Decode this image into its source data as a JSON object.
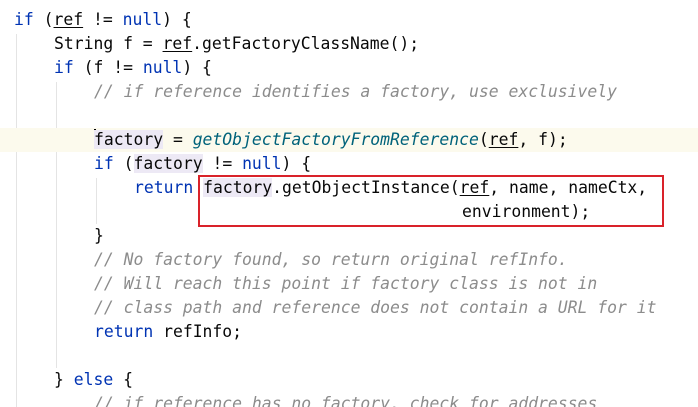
{
  "colors": {
    "keyword": "#0033b3",
    "comment": "#8c8c8c",
    "method_italic": "#00627a",
    "text": "#080808",
    "highlight_box": "#d9222a",
    "current_line": "#fcfaed"
  },
  "code": {
    "l1": {
      "kw_if": "if",
      "paren_open": " (",
      "ref": "ref",
      "rest": " != ",
      "null": "null",
      "tail": ") {"
    },
    "l2": {
      "pre": "String f = ",
      "ref": "ref",
      "rest": ".getFactoryClassName();"
    },
    "l3": {
      "kw_if": "if",
      "mid": " (f != ",
      "null": "null",
      "tail": ") {"
    },
    "l4": {
      "comment": "// if reference identifies a factory, use exclusively"
    },
    "l6": {
      "factory": "factory",
      "eq": " = ",
      "method": "getObjectFactoryFromReference",
      "open": "(",
      "ref": "ref",
      "tail": ", f);"
    },
    "l7": {
      "kw_if": "if",
      "open": " (",
      "factory": "factory",
      "mid": " != ",
      "null": "null",
      "tail": ") {"
    },
    "l8": {
      "kw_return": "return",
      "factory": "factory",
      "call": ".getObjectInstance(",
      "ref": "ref",
      "tail": ", name, nameCtx,"
    },
    "l9": {
      "text": "environment);"
    },
    "l10": {
      "text": "}"
    },
    "l11": {
      "comment": "// No factory found, so return original refInfo."
    },
    "l12": {
      "comment": "// Will reach this point if factory class is not in"
    },
    "l13": {
      "comment": "// class path and reference does not contain a URL for it"
    },
    "l14": {
      "kw_return": "return",
      "tail": " refInfo;"
    },
    "l16": {
      "brace": "} ",
      "kw_else": "else",
      "tail": " {"
    },
    "l17": {
      "comment": "// if reference has no factory, check for addresses"
    }
  }
}
